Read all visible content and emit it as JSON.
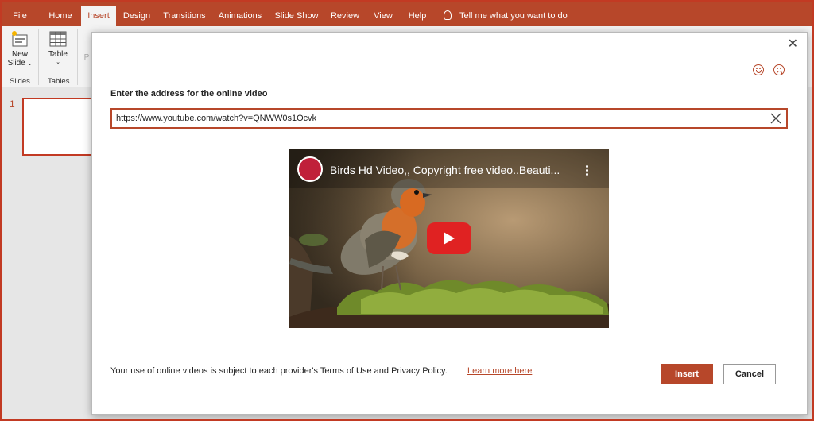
{
  "ribbon_tabs": [
    "File",
    "Home",
    "Insert",
    "Design",
    "Transitions",
    "Animations",
    "Slide Show",
    "Review",
    "View",
    "Help"
  ],
  "tell_me": "Tell me what you want to do",
  "ribbon": {
    "new_slide_line1": "New",
    "new_slide_line2": "Slide",
    "slides_group": "Slides",
    "table_label": "Table",
    "tables_group": "Tables",
    "partial_label": "P"
  },
  "slide_panel": {
    "slide_number": "1"
  },
  "dialog": {
    "prompt": "Enter the address for the online video",
    "url_value": "https://www.youtube.com/watch?v=QNWW0s1Ocvk",
    "video_title": "Birds Hd Video,, Copyright free video..Beauti...",
    "terms_text": "Your use of online videos is subject to each provider's Terms of Use and Privacy Policy.",
    "learn_more": "Learn more here",
    "insert_label": "Insert",
    "cancel_label": "Cancel"
  },
  "colors": {
    "accent": "#b7472a",
    "youtube_red": "#e02222"
  }
}
